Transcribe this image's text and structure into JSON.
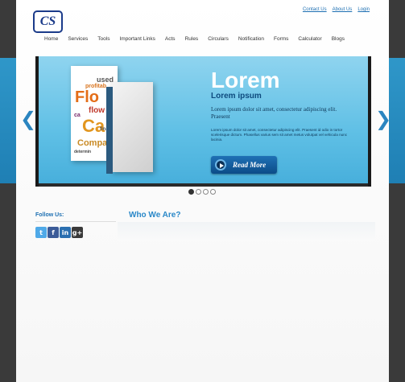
{
  "header": {
    "logo_text": "CS",
    "top_links": [
      "Contact Us",
      "About Us",
      "Login"
    ]
  },
  "nav": {
    "items": [
      "Home",
      "Services",
      "Tools",
      "Important Links",
      "Acts",
      "Rules",
      "Circulars",
      "Notification",
      "Forms",
      "Calculator",
      "Blogs"
    ]
  },
  "slider": {
    "heading": "Lorem",
    "subheading": "Lorem ipsum",
    "paragraph1": "Lorem ipsum dolor sit amet, consectetur adipiscing elit. Praesent",
    "paragraph2": "Lorem ipsum dolor sit amet, consectetur adipiscing elit. Praesent id odio in tortor scelerisque dictum. Phasellus varius sem sit amet metus volutpat vel vehicula nunc lacinia.",
    "button_label": "Read More",
    "prev_arrow": "❮",
    "next_arrow": "❯",
    "book_words": [
      "used",
      "profitab",
      "Flo",
      "flow",
      "ca",
      "Ca",
      "Compa",
      "financ",
      "determin"
    ],
    "dots": [
      true,
      false,
      false,
      false
    ]
  },
  "sidebar": {
    "follow_title": "Follow Us:",
    "social": [
      {
        "icon": "twitter-icon",
        "glyph": "t"
      },
      {
        "icon": "facebook-icon",
        "glyph": "f"
      },
      {
        "icon": "linkedin-icon",
        "glyph": "in"
      },
      {
        "icon": "googleplus-icon",
        "glyph": "g+"
      }
    ]
  },
  "main": {
    "section_title": "Who We Are?"
  },
  "colors": {
    "brand_blue": "#1d6fb2",
    "slider_blue": "#5ebfe5",
    "dark_bg": "#3a3a3a"
  }
}
